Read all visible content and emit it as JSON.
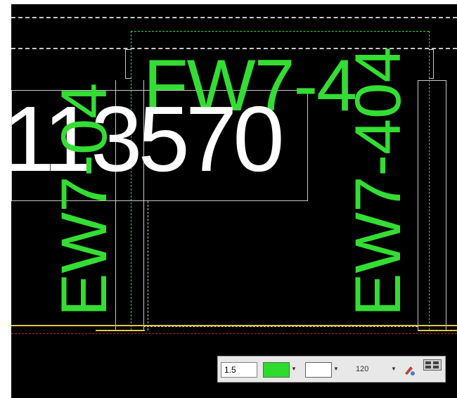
{
  "drawing": {
    "text_top": "FW7-4",
    "text_left_vertical": "EW7-04",
    "text_right_vertical": "EW7-404",
    "text_dimension": "113570",
    "line_color_green": "#33dd33",
    "text_color_white": "#ffffff",
    "line_color_yellow": "#d8c84a",
    "line_color_red": "#c02020"
  },
  "toolbar": {
    "line_width_value": "1.5",
    "fill_color": "#2bdc2b",
    "stroke_color": "#ffffff",
    "opacity_value": "120",
    "icons": [
      "color-swatch-dropdown",
      "outline-swatch-dropdown",
      "opacity-dropdown",
      "pen-icon",
      "grid-icon"
    ]
  }
}
